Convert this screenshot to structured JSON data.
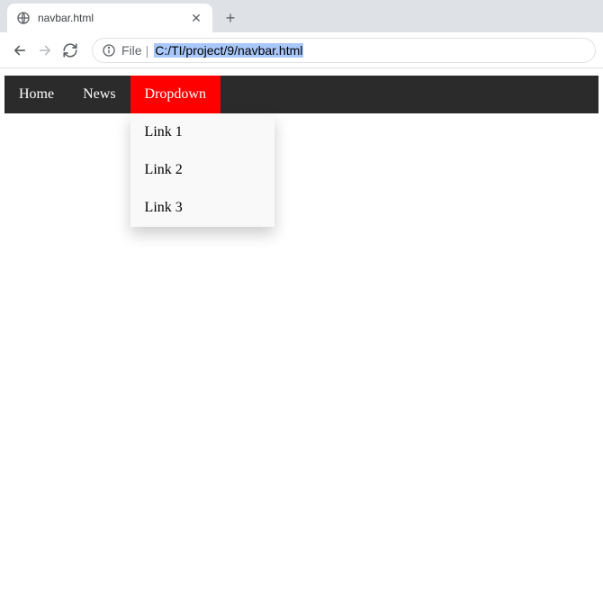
{
  "browser": {
    "tab_title": "navbar.html",
    "file_label": "File",
    "url": "C:/TI/project/9/navbar.html"
  },
  "navbar": {
    "items": [
      {
        "label": "Home"
      },
      {
        "label": "News"
      },
      {
        "label": "Dropdown"
      }
    ],
    "dropdown_links": [
      {
        "label": "Link 1"
      },
      {
        "label": "Link 2"
      },
      {
        "label": "Link 3"
      }
    ]
  }
}
